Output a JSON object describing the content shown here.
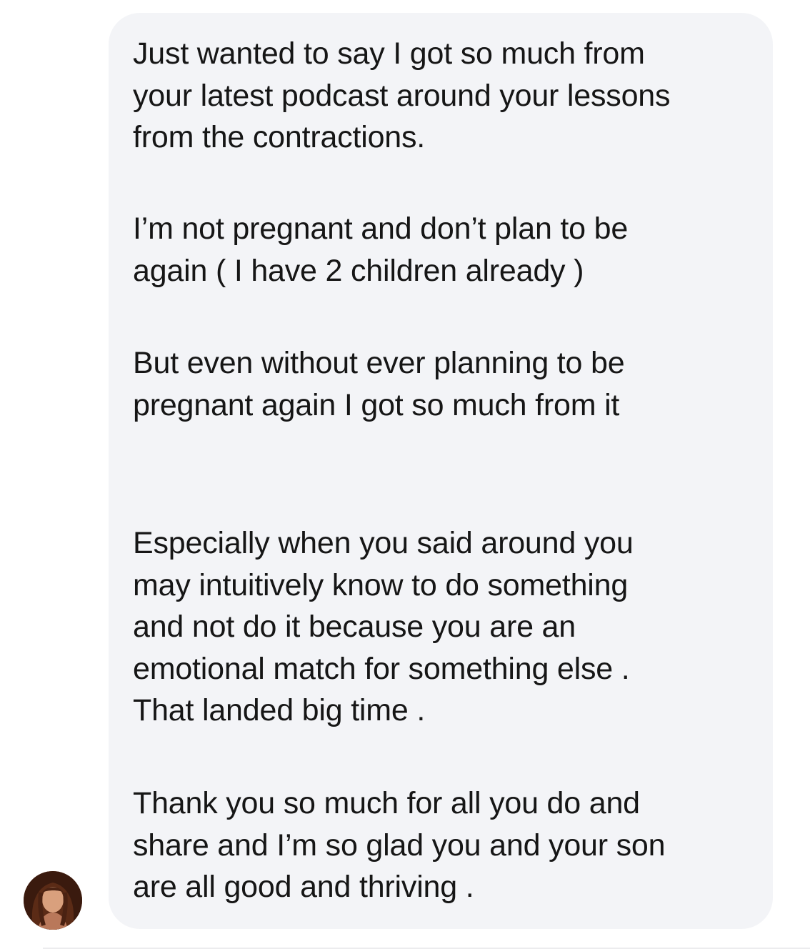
{
  "conversation": {
    "message": {
      "paragraphs": [
        "Just wanted to say I got so much from\nyour latest podcast around your lessons\nfrom the contractions.",
        "I’m not pregnant and don’t plan to be\nagain ( I have 2 children already )",
        "But even without ever planning to be\npregnant again I got so much from it",
        "Especially when you said around you\nmay intuitively know to do something\nand not do it because you are an\nemotional match for something else .\nThat landed big time .",
        "Thank you so much for all you do and\nshare and I’m so glad you and your son\nare all good and thriving ."
      ],
      "bubble_color": "#f3f4f7",
      "text_color": "#161616"
    },
    "sender": {
      "avatar_icon": "profile-photo"
    }
  }
}
